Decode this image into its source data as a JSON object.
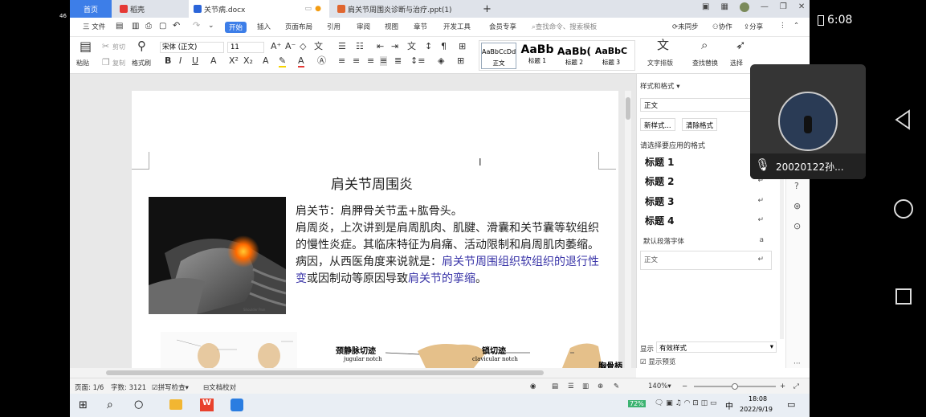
{
  "phone": {
    "signal": "46",
    "time": "6:08"
  },
  "tabs": {
    "home": "首页",
    "daoke": "稻壳",
    "doc": "关节病.docx",
    "ppt": "肩关节周围炎诊断与治疗.ppt(1)"
  },
  "menu": {
    "file": "三 文件",
    "start": "开始",
    "insert": "插入",
    "layout": "页面布局",
    "ref": "引用",
    "review": "审阅",
    "view": "视图",
    "section": "章节",
    "dev": "开发工具",
    "member": "会员专享",
    "search_ph": "查找命令、搜索模板",
    "sync": "未同步",
    "collab": "协作",
    "share": "分享"
  },
  "ribbon": {
    "paste": "粘贴",
    "cut": "剪切",
    "copy": "复制",
    "format_painter": "格式刷",
    "font": "宋体 (正文)",
    "size": "11",
    "styles": [
      {
        "sample": "AaBbCcDd",
        "name": "正文"
      },
      {
        "sample": "AaBb",
        "name": "标题 1"
      },
      {
        "sample": "AaBb(",
        "name": "标题 2"
      },
      {
        "sample": "AaBbC",
        "name": "标题 3"
      }
    ],
    "text_layout": "文字排版",
    "find_replace": "查找替换",
    "select": "选择"
  },
  "doc": {
    "title": "肩关节周围炎",
    "para1": "肩关节：肩胛骨关节盂+肱骨头。",
    "para2a": "肩周炎，上次讲到是肩周肌肉、肌腱、滑囊和关节囊等软组织的慢性炎症。其临床特征为肩痛、活动限制和肩周肌肉萎缩。病因，从西医角度来说就是：",
    "para2b": "肩关节周围组织软组织的退行性变",
    "para2c": "或因制动等原因导致",
    "para2d": "肩关节的挛缩",
    "para2e": "。",
    "label_jugular": "颈静脉切迹",
    "label_jugular_en": "jugular notch",
    "label_clav": "锁切迹",
    "label_clav_en": "clavicular notch",
    "label_right": "胸骨柄"
  },
  "panel": {
    "title": "样式和格式",
    "current": "正文",
    "new_style": "新样式...",
    "clear_format": "清除格式",
    "choose": "请选择要应用的格式",
    "styles": [
      "标题 1",
      "标题 2",
      "标题 3",
      "标题 4"
    ],
    "default_font": "默认段落字体",
    "body": "正文",
    "show_label": "显示",
    "show_value": "有效样式",
    "preview": "显示预览"
  },
  "status": {
    "page": "页面: 1/6",
    "words": "字数: 3121",
    "spell": "拼写检查",
    "proof": "文档校对",
    "zoom": "140%"
  },
  "taskbar": {
    "battery": "72%",
    "ime": "中",
    "clock_time": "18:08",
    "clock_date": "2022/9/19"
  },
  "meeting": {
    "name": "20020122孙..."
  }
}
